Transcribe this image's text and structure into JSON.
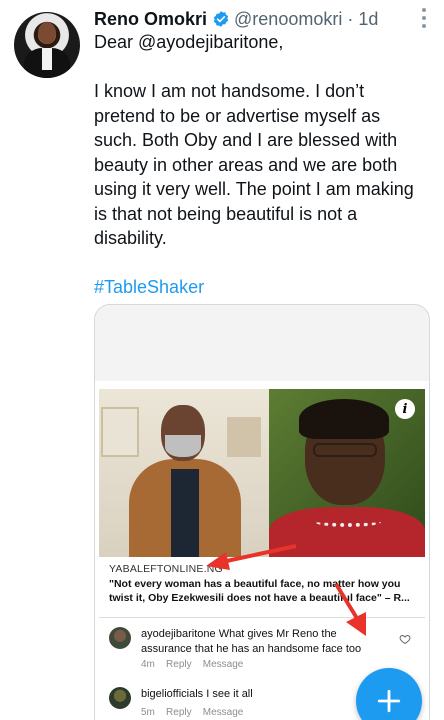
{
  "tweet": {
    "author_name": "Reno Omokri",
    "handle": "@renoomokri",
    "separator": "·",
    "time": "1d",
    "lines": [
      "Dear @ayodejibaritone,",
      "",
      "I know I am not handsome. I don’t",
      "pretend to be or advertise myself as",
      "such. Both Oby and I are blessed with",
      "beauty in other areas and we are both",
      "using it very well. The point I am making",
      "is that not being beautiful is not a",
      "disability.",
      ""
    ],
    "hashtag": "#TableShaker"
  },
  "card": {
    "source": "YABALEFTONLINE.NG",
    "quote_line1": "\"Not every woman has a beautiful face, no matter how you",
    "quote_line2": "twist it, Oby Ezekwesili does not have a beautiful face\" – R...",
    "comments": [
      {
        "user": "ayodejibaritone",
        "text_line1": "What gives Mr Reno the",
        "text_line2": "assurance that he has an handsome face too",
        "age": "4m",
        "reply": "Reply",
        "message": "Message"
      },
      {
        "user": "bigeliofficials",
        "text_line1": "I see it all",
        "age": "5m",
        "reply": "Reply",
        "message": "Message"
      }
    ]
  },
  "icons": {
    "verified": "verified-badge-icon",
    "more": "more-vertical-icon",
    "info": "info-icon",
    "heart": "heart-outline-icon",
    "compose": "plus-icon"
  },
  "colors": {
    "accent": "#1d9bf0",
    "text": "#0f1419",
    "muted": "#536471",
    "annotation_arrow": "#e8322a"
  }
}
